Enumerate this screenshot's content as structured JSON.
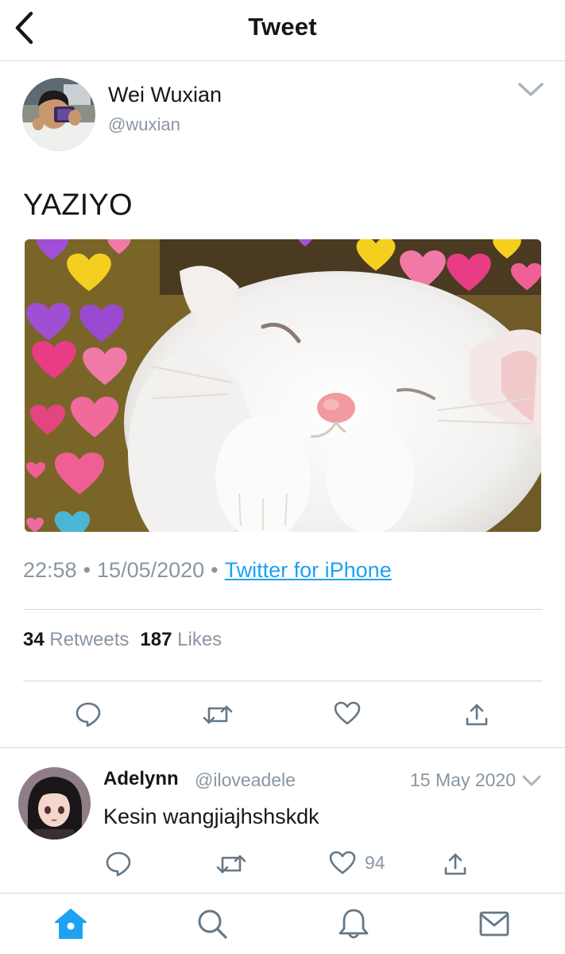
{
  "header": {
    "title": "Tweet",
    "back_icon": "chevron-left-icon"
  },
  "tweet": {
    "author_name": "Wei Wuxian",
    "author_handle": "@wuxian",
    "text": "YAZIYO",
    "time": "22:58",
    "date": "15/05/2020",
    "source": "Twitter for iPhone",
    "retweet_count": "34",
    "retweet_label": "Retweets",
    "like_count": "187",
    "like_label": "Likes",
    "media_description": "white-cat-with-hearts-photo"
  },
  "actions": {
    "reply_icon": "reply-bubble-icon",
    "retweet_icon": "retweet-icon",
    "like_icon": "heart-icon",
    "share_icon": "share-icon"
  },
  "reply": {
    "author_name": "Adelynn",
    "author_handle": "@iloveadele",
    "date": "15 May 2020",
    "text": "Kesin wangjiajhshskdk",
    "like_count": "94"
  },
  "tabbar": {
    "items": [
      "home-icon",
      "search-icon",
      "notifications-bell-icon",
      "messages-envelope-icon"
    ],
    "active": "home-icon"
  },
  "colors": {
    "accent": "#1da1f2",
    "muted_text": "#8a96a1",
    "icon_gray": "#657786",
    "divider": "#d5d8db"
  }
}
